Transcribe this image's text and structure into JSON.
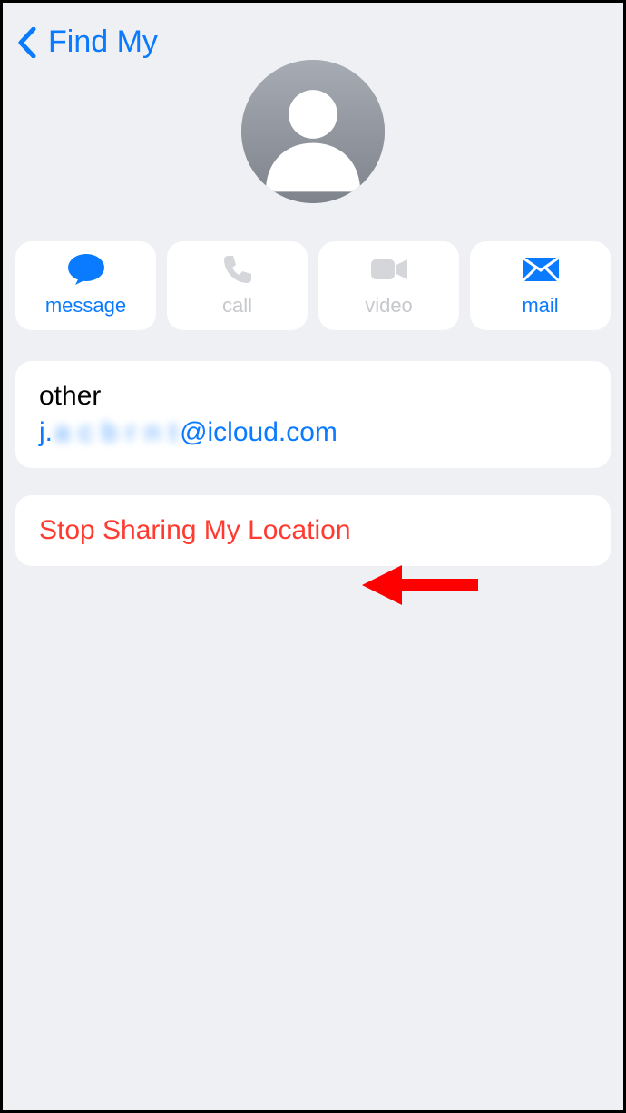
{
  "header": {
    "back_label": "Find My"
  },
  "actions": {
    "message": "message",
    "call": "call",
    "video": "video",
    "mail": "mail"
  },
  "contact": {
    "field_label": "other",
    "email_prefix": "j.",
    "email_obscured": "a c b r n t",
    "email_suffix": "@icloud.com"
  },
  "stop_sharing_label": "Stop Sharing My Location"
}
